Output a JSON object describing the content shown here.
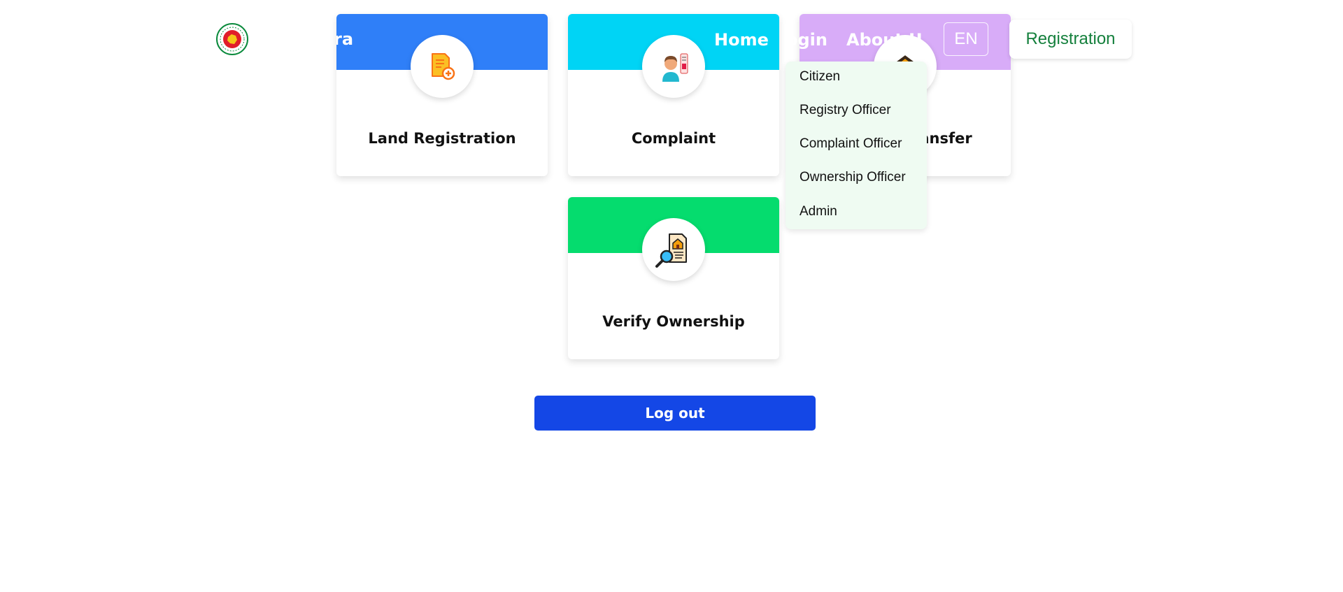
{
  "header": {
    "brand_fragment": "ra",
    "nav_home": "Home",
    "nav_login_fragment": "ogin",
    "nav_about_fragment": "About Us",
    "language": "EN",
    "registration": "Registration",
    "text_color": "#ffffff",
    "registration_color": "#15803d"
  },
  "registration_dropdown": {
    "items": [
      "Citizen",
      "Registry Officer",
      "Complaint Officer",
      "Ownership Officer",
      "Admin"
    ]
  },
  "cards": [
    {
      "title": "Land Registration",
      "band_color": "#2f7ff8",
      "icon": "document-add-icon"
    },
    {
      "title": "Complaint",
      "band_color": "#00d4f5",
      "icon": "person-complaint-icon"
    },
    {
      "title_fragment": "ransfer",
      "band_color": "#d8acf8",
      "icon": "house-transfer-icon"
    },
    {
      "title": "Verify Ownership",
      "band_color": "#05dc6e",
      "icon": "search-document-icon"
    }
  ],
  "logout": {
    "label": "Log out",
    "color": "#1447e6"
  }
}
